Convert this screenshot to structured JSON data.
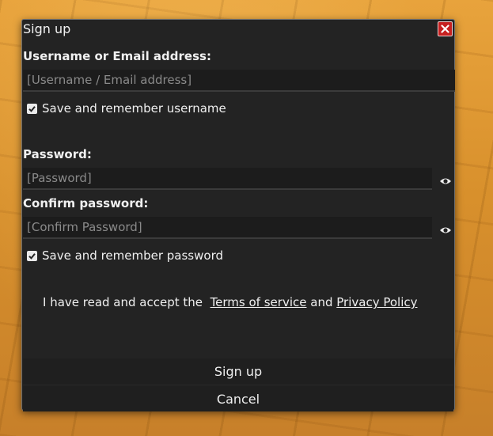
{
  "dialog": {
    "title": "Sign up"
  },
  "username": {
    "label": "Username or Email address:",
    "placeholder": "[Username / Email address]",
    "remember_label": "Save and remember username",
    "remember_checked": true
  },
  "password": {
    "label": "Password:",
    "placeholder": "[Password]"
  },
  "confirm_password": {
    "label": "Confirm password:",
    "placeholder": "[Confirm Password]",
    "remember_label": "Save and remember password",
    "remember_checked": true
  },
  "terms": {
    "prefix": "I have read and accept the",
    "terms_link": "Terms of service",
    "joiner": "and",
    "privacy_link": "Privacy Policy"
  },
  "actions": {
    "signup_label": "Sign up",
    "cancel_label": "Cancel"
  },
  "icons": {
    "close": "close-icon",
    "checkbox": "checkmark-icon",
    "show_password": "eye-icon"
  },
  "colors": {
    "dialog_bg": "#232323",
    "close_bg": "#c62020",
    "text": "#f0f0f0",
    "placeholder": "#8a8a8a"
  }
}
